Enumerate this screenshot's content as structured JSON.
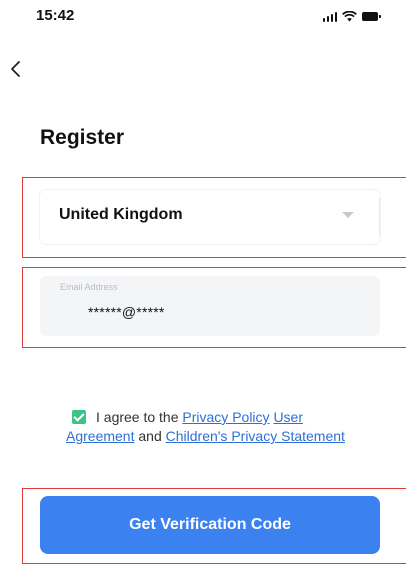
{
  "status_bar": {
    "time": "15:42",
    "icons": [
      "signal-icon",
      "wifi-icon",
      "battery-icon"
    ]
  },
  "header": {
    "back_icon": "chevron-left-icon",
    "title": "Register"
  },
  "form": {
    "country": {
      "value": "United Kingdom",
      "icon": "caret-down-icon"
    },
    "email": {
      "label": "Email Address",
      "value": "******@*****"
    }
  },
  "agreement": {
    "checked": true,
    "prefix": "I agree to the",
    "privacy_policy": "Privacy Policy",
    "user_agreement": "User Agreement",
    "and_text": "and",
    "childrens_privacy": "Children's Privacy Statement"
  },
  "actions": {
    "verify_label": "Get Verification Code"
  },
  "colors": {
    "primary": "#3b82f0",
    "link": "#2e6fd6",
    "checkbox": "#3bc48a",
    "highlight": "#e23b3b"
  }
}
